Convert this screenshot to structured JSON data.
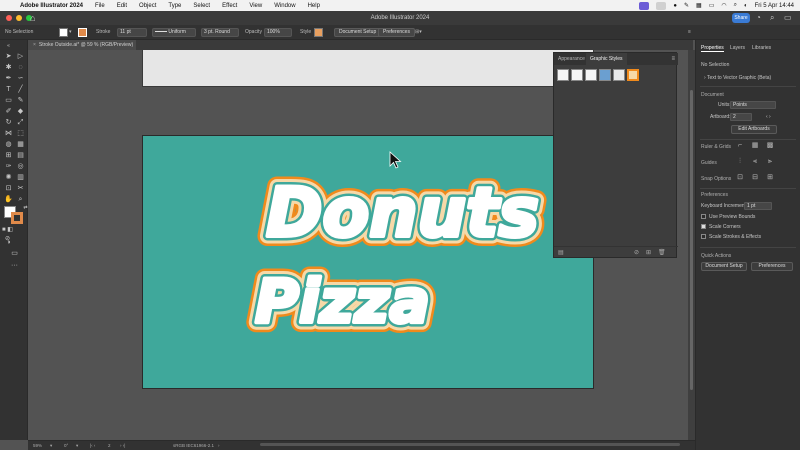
{
  "macos_menu": {
    "app_name": "Adobe Illustrator 2024",
    "menus": [
      "File",
      "Edit",
      "Object",
      "Type",
      "Select",
      "Effect",
      "View",
      "Window",
      "Help"
    ],
    "datetime": "Fri 5 Apr  14:44"
  },
  "window": {
    "title": "Adobe Illustrator 2024",
    "share_label": "Share"
  },
  "control_bar": {
    "selection_label": "No Selection",
    "stroke_label": "Stroke",
    "stroke_weight": "11 pt",
    "stroke_profile": "Uniform",
    "brush": "3 pt. Round",
    "opacity_label": "Opacity",
    "opacity_value": "100%",
    "style_label": "Style",
    "document_setup_label": "Document Setup",
    "preferences_label": "Preferences"
  },
  "document_tab": {
    "label": "Stroke Outside.ai* @ 59 % (RGB/Preview)"
  },
  "artwork": {
    "words": [
      "Donuts",
      "Pizza"
    ],
    "background_color": "#3fa89b"
  },
  "graphic_styles_panel": {
    "tabs": [
      "Appearance",
      "Graphic Styles"
    ],
    "active_tab": "Graphic Styles"
  },
  "properties_panel": {
    "tabs": [
      "Properties",
      "Layers",
      "Libraries"
    ],
    "selection": "No Selection",
    "convert_label": "Text to Vector Graphic (Beta)",
    "document_heading": "Document",
    "units_label": "Units:",
    "units_value": "Points",
    "artboard_label": "Artboard:",
    "artboard_value": "2",
    "edit_artboards_label": "Edit Artboards",
    "rulers_label": "Ruler & Grids",
    "guides_label": "Guides",
    "snap_label": "Snap Options",
    "preferences_heading": "Preferences",
    "keyboard_increment_label": "Keyboard Increment:",
    "keyboard_increment_value": "1 pt",
    "checkboxes": [
      {
        "label": "Use Preview Bounds",
        "checked": false
      },
      {
        "label": "Scale Corners",
        "checked": true
      },
      {
        "label": "Scale Strokes & Effects",
        "checked": false
      }
    ],
    "quick_actions_heading": "Quick Actions",
    "document_setup_label": "Document Setup",
    "preferences_label": "Preferences"
  },
  "status_bar": {
    "zoom": "59%",
    "rotation": "0°",
    "artboard_number": "2",
    "profile": "sRGB IEC61966-2.1"
  },
  "colors": {
    "accent": "#3a7bd5",
    "artboard": "#3fa89b",
    "text_outline_orange": "#f08a1c",
    "text_outline_cream": "#f6d9a8"
  }
}
